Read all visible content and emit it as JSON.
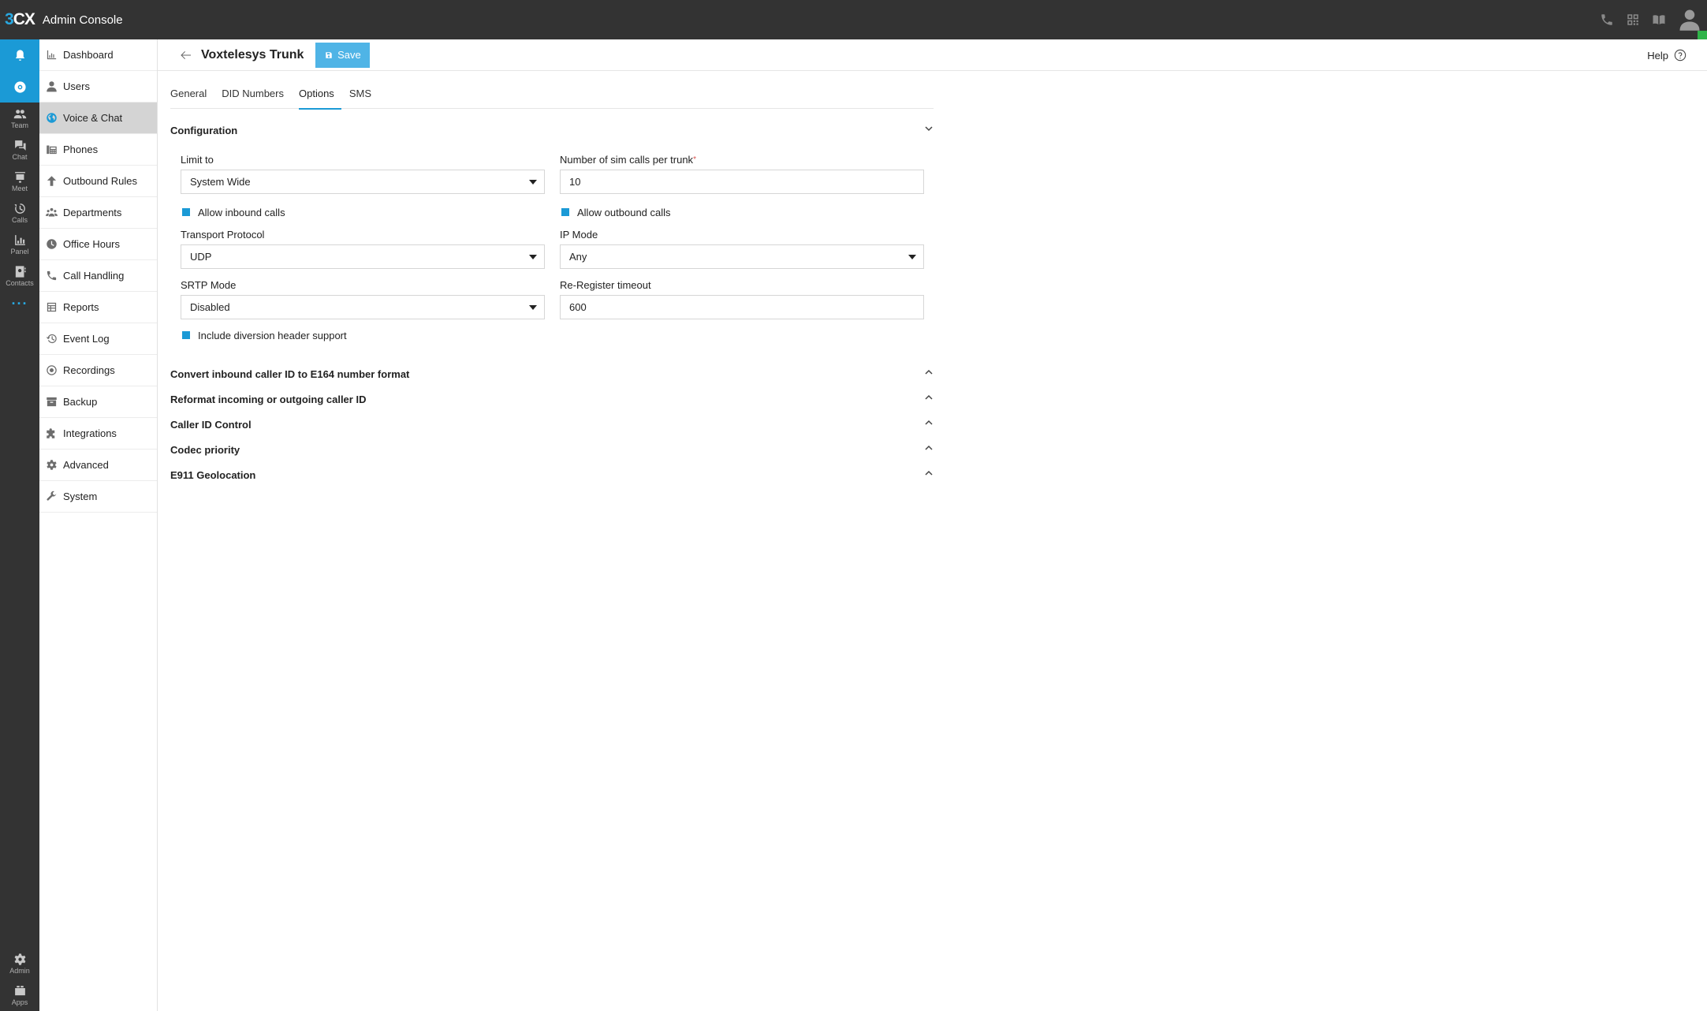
{
  "app": {
    "logo_text_1": "3",
    "logo_text_2": "CX",
    "title": "Admin Console"
  },
  "topbar_icons": [
    "phone-icon",
    "qr-code-icon",
    "book-icon",
    "user-avatar-icon"
  ],
  "rail": {
    "items": [
      {
        "icon": "bell-icon",
        "label": ""
      },
      {
        "icon": "chrome-icon",
        "label": ""
      },
      {
        "icon": "team-icon",
        "label": "Team"
      },
      {
        "icon": "chat-icon",
        "label": "Chat"
      },
      {
        "icon": "meet-icon",
        "label": "Meet"
      },
      {
        "icon": "calls-icon",
        "label": "Calls"
      },
      {
        "icon": "panel-icon",
        "label": "Panel"
      },
      {
        "icon": "contacts-icon",
        "label": "Contacts"
      }
    ],
    "more": "···",
    "bottom": [
      {
        "icon": "gear-icon",
        "label": "Admin"
      },
      {
        "icon": "apps-icon",
        "label": "Apps"
      }
    ]
  },
  "sidebar": {
    "items": [
      {
        "label": "Dashboard",
        "icon": "dashboard-icon"
      },
      {
        "label": "Users",
        "icon": "user-icon"
      },
      {
        "label": "Voice & Chat",
        "icon": "globe-icon",
        "active": true
      },
      {
        "label": "Phones",
        "icon": "phones-icon"
      },
      {
        "label": "Outbound Rules",
        "icon": "arrow-up-icon"
      },
      {
        "label": "Departments",
        "icon": "departments-icon"
      },
      {
        "label": "Office Hours",
        "icon": "clock-icon"
      },
      {
        "label": "Call Handling",
        "icon": "phone-icon"
      },
      {
        "label": "Reports",
        "icon": "reports-icon"
      },
      {
        "label": "Event Log",
        "icon": "history-icon"
      },
      {
        "label": "Recordings",
        "icon": "record-icon"
      },
      {
        "label": "Backup",
        "icon": "archive-icon"
      },
      {
        "label": "Integrations",
        "icon": "puzzle-icon"
      },
      {
        "label": "Advanced",
        "icon": "gear-icon"
      },
      {
        "label": "System",
        "icon": "wrench-icon"
      }
    ]
  },
  "header": {
    "title": "Voxtelesys Trunk",
    "save_label": "Save",
    "help_label": "Help"
  },
  "tabs": [
    {
      "label": "General"
    },
    {
      "label": "DID Numbers"
    },
    {
      "label": "Options",
      "active": true
    },
    {
      "label": "SMS"
    }
  ],
  "configuration": {
    "title": "Configuration",
    "limit_to": {
      "label": "Limit to",
      "value": "System Wide"
    },
    "sim_calls": {
      "label": "Number of sim calls per trunk",
      "required_mark": "*",
      "value": "10"
    },
    "allow_inbound": {
      "label": "Allow inbound calls",
      "checked": true
    },
    "allow_outbound": {
      "label": "Allow outbound calls",
      "checked": true
    },
    "transport": {
      "label": "Transport Protocol",
      "value": "UDP"
    },
    "ip_mode": {
      "label": "IP Mode",
      "value": "Any"
    },
    "srtp": {
      "label": "SRTP Mode",
      "value": "Disabled"
    },
    "reregister": {
      "label": "Re-Register timeout",
      "value": "600"
    },
    "diversion": {
      "label": "Include diversion header support",
      "checked": true
    }
  },
  "sections": [
    {
      "title": "Convert inbound caller ID to E164 number format"
    },
    {
      "title": "Reformat incoming or outgoing caller ID"
    },
    {
      "title": "Caller ID Control"
    },
    {
      "title": "Codec priority"
    },
    {
      "title": "E911 Geolocation"
    }
  ],
  "colors": {
    "accent": "#1b9ad6",
    "topbar": "#333333",
    "save_button": "#4fb4e6",
    "presence": "#2fb449"
  }
}
